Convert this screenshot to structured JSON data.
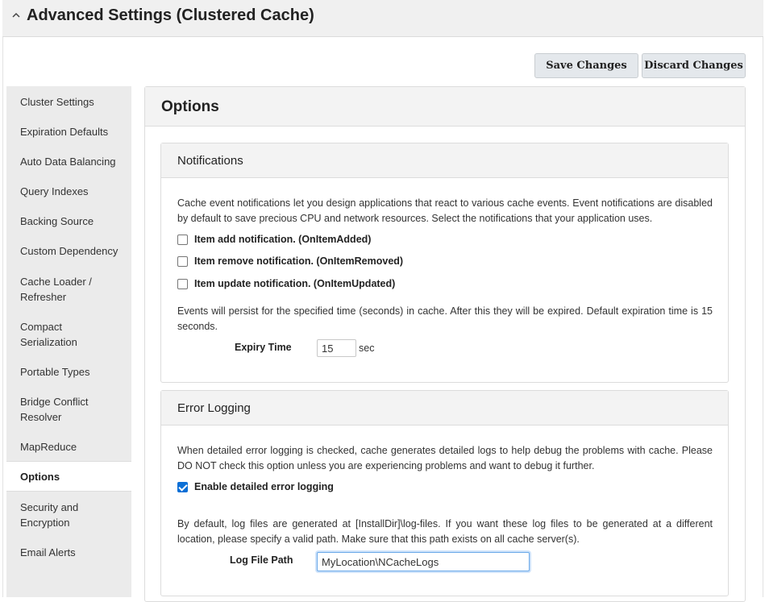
{
  "header": {
    "title": "Advanced Settings (Clustered Cache)",
    "chevron_icon": "chevron-up-icon"
  },
  "toolbar": {
    "save_label": "Save Changes",
    "discard_label": "Discard Changes"
  },
  "sidebar": {
    "items": [
      {
        "label": "Cluster Settings"
      },
      {
        "label": "Expiration Defaults"
      },
      {
        "label": "Auto Data Balancing"
      },
      {
        "label": "Query Indexes"
      },
      {
        "label": "Backing Source"
      },
      {
        "label": "Custom Dependency"
      },
      {
        "label": "Cache Loader / Refresher"
      },
      {
        "label": "Compact Serialization"
      },
      {
        "label": "Portable Types"
      },
      {
        "label": "Bridge Conflict Resolver"
      },
      {
        "label": "MapReduce"
      },
      {
        "label": "Options",
        "active": true
      },
      {
        "label": "Security and Encryption"
      },
      {
        "label": "Email Alerts"
      }
    ]
  },
  "main": {
    "title": "Options",
    "notifications": {
      "title": "Notifications",
      "description": "Cache event notifications let you design applications that react to various cache events. Event notifications are disabled by default to save precious CPU and network resources. Select the notifications that your application uses.",
      "checkboxes": [
        {
          "label": "Item add notification. (OnItemAdded)",
          "checked": false
        },
        {
          "label": "Item remove notification. (OnItemRemoved)",
          "checked": false
        },
        {
          "label": "Item update notification. (OnItemUpdated)",
          "checked": false
        }
      ],
      "persist_text": "Events will persist for the specified time (seconds) in cache. After this they will be expired. Default expiration time is 15 seconds.",
      "expiry_label": "Expiry Time",
      "expiry_value": "15",
      "expiry_unit": "sec"
    },
    "error_logging": {
      "title": "Error Logging",
      "description": "When detailed error logging is checked, cache generates detailed logs to help debug the problems with cache. Please DO NOT check this option unless you are experiencing problems and want to debug it further.",
      "checkbox": {
        "label": "Enable detailed error logging",
        "checked": true
      },
      "path_text": "By default, log files are generated at [InstallDir]\\log-files. If you want these log files to be generated at a different location, please specify a valid path. Make sure that this path exists on all cache server(s).",
      "path_label": "Log File Path",
      "path_value": "MyLocation\\NCacheLogs"
    }
  }
}
